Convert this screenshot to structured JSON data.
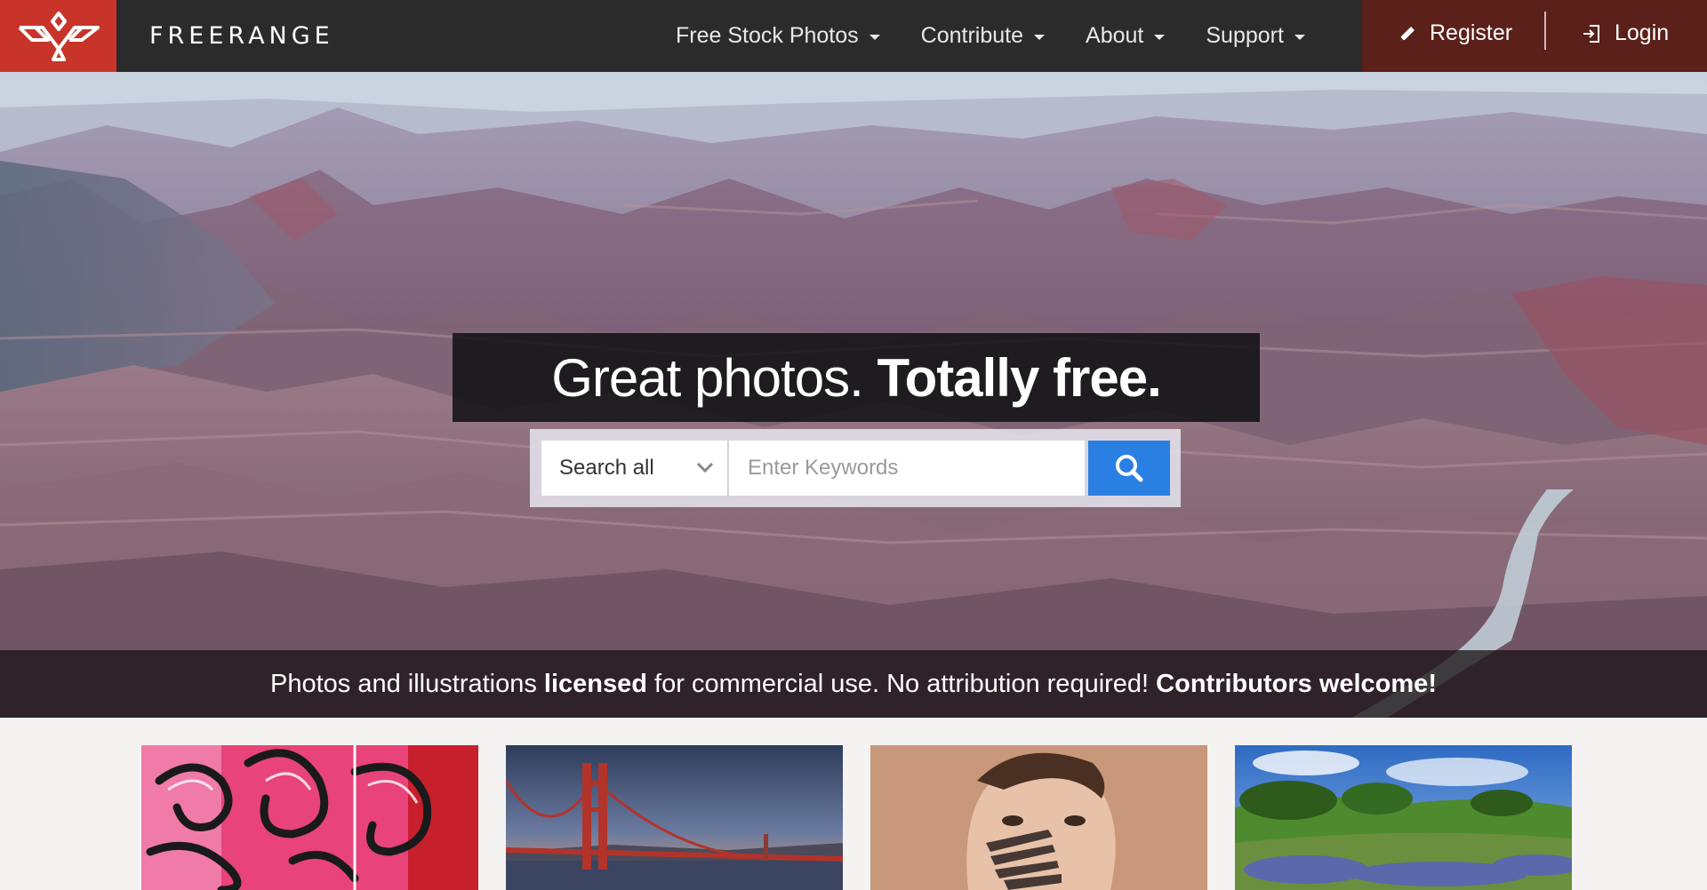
{
  "brand": {
    "name": "FREERANGE",
    "logo_icon": "freerange-logo-icon",
    "accent_color": "#c8342a"
  },
  "nav": {
    "items": [
      {
        "label": "Free Stock Photos",
        "icon": "caret-down-icon"
      },
      {
        "label": "Contribute",
        "icon": "caret-down-icon"
      },
      {
        "label": "About",
        "icon": "caret-down-icon"
      },
      {
        "label": "Support",
        "icon": "caret-down-icon"
      }
    ],
    "register": {
      "label": "Register",
      "icon": "pencil-icon"
    },
    "login": {
      "label": "Login",
      "icon": "login-icon"
    }
  },
  "hero": {
    "headline_regular": "Great photos.",
    "headline_bold": "Totally free.",
    "search": {
      "scope_selected": "Search all",
      "placeholder": "Enter Keywords",
      "button_icon": "search-icon",
      "button_color": "#2a7fe2"
    },
    "tagline": {
      "part1": "Photos and illustrations ",
      "bold1": "licensed",
      "part2": " for commercial use. No attribution required! ",
      "bold2": "Contributors welcome!"
    }
  },
  "thumbnails": [
    {
      "subject": "graffiti-thumbnail"
    },
    {
      "subject": "golden-gate-bridge-thumbnail"
    },
    {
      "subject": "painted-face-portrait-thumbnail"
    },
    {
      "subject": "bluebonnet-meadow-thumbnail"
    }
  ]
}
